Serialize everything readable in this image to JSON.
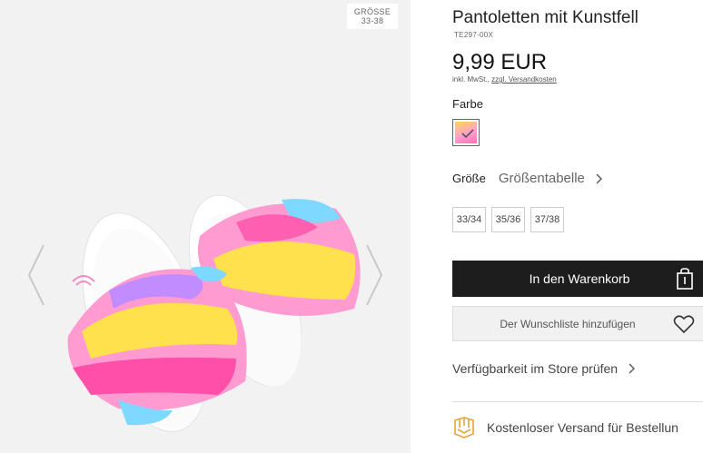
{
  "gallery": {
    "size_badge_line1": "GRÖSSE",
    "size_badge_line2": "33-38",
    "prev_icon": "chevron-left-icon",
    "next_icon": "chevron-right-icon"
  },
  "product": {
    "title": "Pantoletten mit Kunstfell",
    "sku": "TE297-00X",
    "price": "9,99 EUR",
    "tax_note": "inkl. MwSt.,",
    "shipping_link": "zzgl. Versandkosten"
  },
  "color": {
    "label": "Farbe",
    "selected_icon": "check-icon"
  },
  "size": {
    "label": "Größe",
    "guide_label": "Größentabelle",
    "options": [
      "33/34",
      "35/36",
      "37/38"
    ]
  },
  "actions": {
    "cart_label": "In den Warenkorb",
    "cart_icon": "shopping-bag-icon",
    "wishlist_label": "Der Wunschliste hinzufügen",
    "wishlist_icon": "heart-icon",
    "store_check_label": "Verfügbarkeit im Store prüfen"
  },
  "shipping": {
    "label": "Kostenloser Versand für Bestellun",
    "icon": "box-icon"
  },
  "colors": {
    "primary_button": "#1d1d1d",
    "secondary_button": "#f1f1f1",
    "accent_icon": "#e8a33a"
  }
}
